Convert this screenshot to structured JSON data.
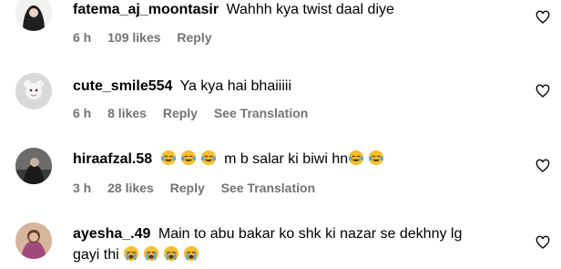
{
  "comments": [
    {
      "username": "fatema_aj_moontasir",
      "text": "Wahhh kya twist daal diye",
      "time": "6 h",
      "likes": "109 likes",
      "reply": "Reply"
    },
    {
      "username": "cute_smile554",
      "text": "Ya kya hai bhaiiiii",
      "time": "6 h",
      "likes": "8 likes",
      "reply": "Reply",
      "translate": "See Translation"
    },
    {
      "username": "hiraafzal.58",
      "text": "m b salar ki biwi hn",
      "time": "3 h",
      "likes": "28 likes",
      "reply": "Reply",
      "translate": "See Translation"
    },
    {
      "username": "ayesha_.49",
      "text_line1": "Main to abu bakar ko shk ki nazar se dekhny lg",
      "text_line2": "gayi thi"
    }
  ],
  "icons": {
    "like": "heart-outline-icon",
    "laugh": "face-with-tears-of-joy-icon",
    "cry": "loudly-crying-face-icon"
  },
  "colors": {
    "meta": "#737373",
    "emoji": "#f5c02f"
  }
}
